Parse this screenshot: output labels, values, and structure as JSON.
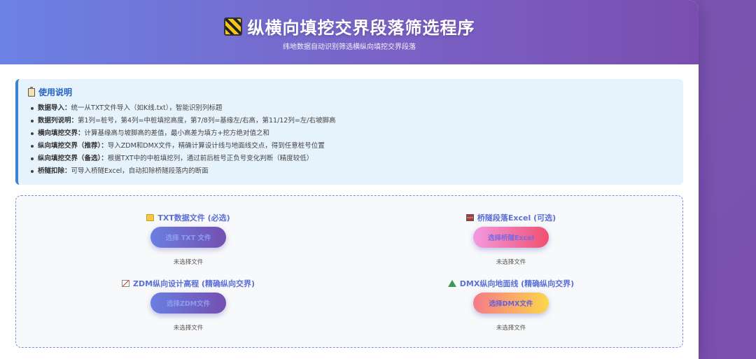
{
  "header": {
    "title": "纵横向填挖交界段落筛选程序",
    "subtitle": "纬地数据自动识别筛选横纵向填挖交界段落",
    "icon": "construction-barrier-icon"
  },
  "instructions": {
    "title": "使用说明",
    "icon": "clipboard-icon",
    "items": [
      {
        "label": "数据导入：",
        "text": "统一从TXT文件导入（如K线.txt），智能识别列标题"
      },
      {
        "label": "数据列说明：",
        "text": "第1列=桩号，第4列=中桩填挖高度，第7/8列=基缘左/右高，第11/12列=左/右坡脚高"
      },
      {
        "label": "横向填挖交界：",
        "text": "计算基缘高与坡脚高的差值，最小高差为填方+挖方绝对值之和"
      },
      {
        "label": "纵向填挖交界（推荐）：",
        "text": "导入ZDM和DMX文件，精确计算设计线与地面线交点，得到任意桩号位置"
      },
      {
        "label": "纵向填挖交界（备选）：",
        "text": "根据TXT中的中桩填挖列，通过前后桩号正负号变化判断（精度较低）"
      },
      {
        "label": "桥隧扣除：",
        "text": "可导入桥隧Excel，自动扣除桥隧段落内的断面"
      }
    ]
  },
  "uploads": {
    "txt": {
      "label": "TXT数据文件 (必选)",
      "button": "选择 TXT 文件",
      "status": "未选择文件"
    },
    "bridge": {
      "label": "桥隧段落Excel (可选)",
      "button": "选择桥隧Excel",
      "status": "未选择文件"
    },
    "zdm": {
      "label": "ZDM纵向设计高程 (精确纵向交界)",
      "button": "选择ZDM文件",
      "status": "未选择文件"
    },
    "dmx": {
      "label": "DMX纵向地面线 (精确纵向交界)",
      "button": "选择DMX文件",
      "status": "未选择文件"
    }
  }
}
